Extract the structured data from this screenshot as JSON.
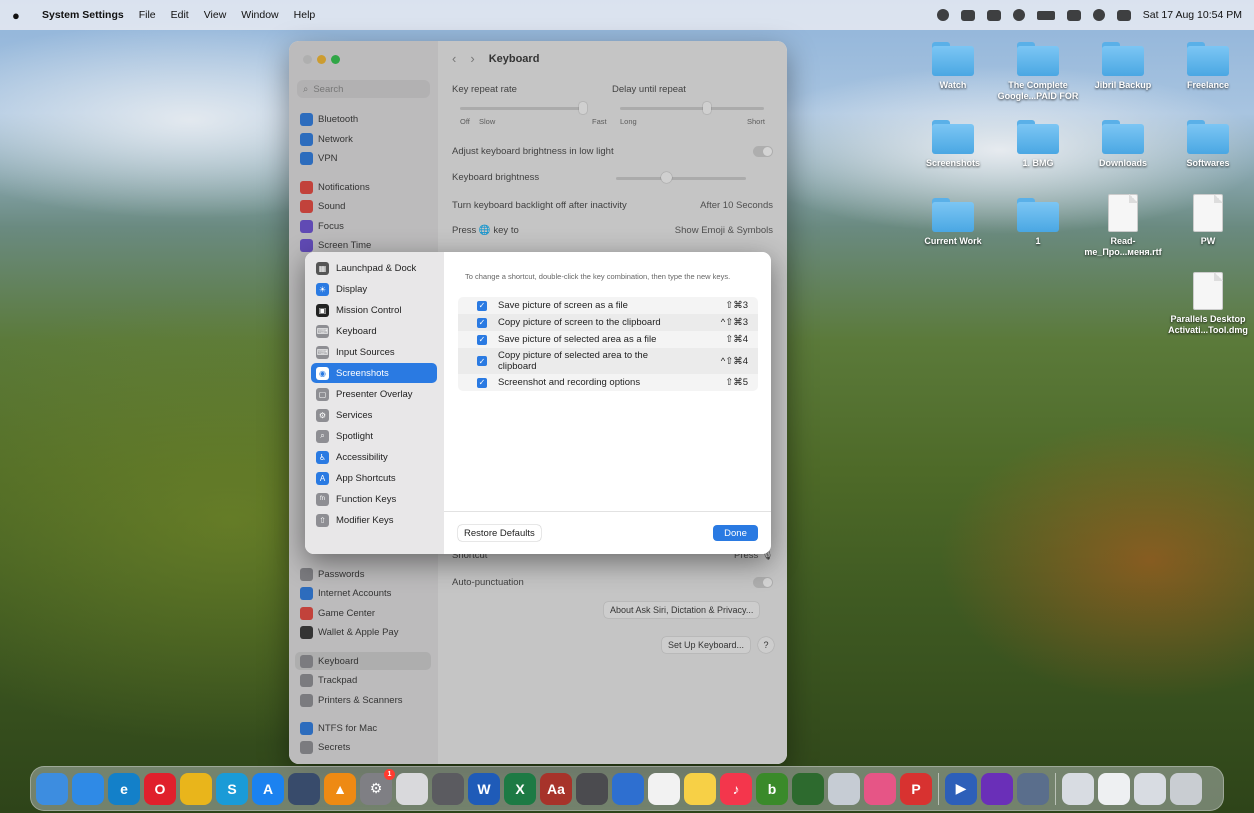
{
  "menubar": {
    "app_name": "System Settings",
    "menus": [
      "File",
      "Edit",
      "View",
      "Window",
      "Help"
    ],
    "clock": "Sat 17 Aug  10:54 PM"
  },
  "desktop": {
    "items": [
      {
        "label": "Watch",
        "kind": "folder"
      },
      {
        "label": "The Complete Google...PAID FOR",
        "kind": "folder"
      },
      {
        "label": "Jibril Backup",
        "kind": "folder"
      },
      {
        "label": "Freelance",
        "kind": "folder"
      },
      {
        "label": "Screenshots",
        "kind": "folder"
      },
      {
        "label": "1. BMG",
        "kind": "folder"
      },
      {
        "label": "Downloads",
        "kind": "folder"
      },
      {
        "label": "Softwares",
        "kind": "folder"
      },
      {
        "label": "Current Work",
        "kind": "folder"
      },
      {
        "label": "1",
        "kind": "folder"
      },
      {
        "label": "Read-me_Про...меня.rtf",
        "kind": "file"
      },
      {
        "label": "PW",
        "kind": "file"
      },
      {
        "label": "Parallels Desktop Activati...Tool.dmg",
        "kind": "file"
      }
    ]
  },
  "settings": {
    "search_placeholder": "Search",
    "title": "Keyboard",
    "sidebar": [
      {
        "label": "Bluetooth",
        "color": "#2a7ae2"
      },
      {
        "label": "Network",
        "color": "#2a7ae2"
      },
      {
        "label": "VPN",
        "color": "#2a7ae2"
      },
      {
        "label": "Notifications",
        "color": "#e8453c"
      },
      {
        "label": "Sound",
        "color": "#e8453c"
      },
      {
        "label": "Focus",
        "color": "#6b4fd6"
      },
      {
        "label": "Screen Time",
        "color": "#6b4fd6"
      },
      {
        "label": "Passwords",
        "color": "#8e8e93"
      },
      {
        "label": "Internet Accounts",
        "color": "#2a7ae2"
      },
      {
        "label": "Game Center",
        "color": "#e8453c"
      },
      {
        "label": "Wallet & Apple Pay",
        "color": "#333333"
      },
      {
        "label": "Keyboard",
        "color": "#8e8e93"
      },
      {
        "label": "Trackpad",
        "color": "#8e8e93"
      },
      {
        "label": "Printers & Scanners",
        "color": "#8e8e93"
      },
      {
        "label": "NTFS for Mac",
        "color": "#2a7ae2"
      },
      {
        "label": "Secrets",
        "color": "#8e8e93"
      }
    ],
    "main": {
      "key_repeat_rate": "Key repeat rate",
      "delay_until_repeat": "Delay until repeat",
      "repeat_scale": [
        "Off",
        "Slow",
        "Fast"
      ],
      "delay_scale": [
        "Long",
        "Short"
      ],
      "adjust_brightness": "Adjust keyboard brightness in low light",
      "keyboard_brightness": "Keyboard brightness",
      "backlight_off": "Turn keyboard backlight off after inactivity",
      "backlight_value": "After 10 Seconds",
      "press_key": "Press 🌐 key to",
      "press_key_value": "Show Emoji & Symbols",
      "shortcut": "Shortcut",
      "shortcut_value": "Press 🎙",
      "auto_punctuation": "Auto-punctuation",
      "about_siri": "About Ask Siri, Dictation & Privacy...",
      "setup_keyboard": "Set Up Keyboard...",
      "help": "?"
    }
  },
  "sheet": {
    "categories": [
      {
        "label": "Launchpad & Dock",
        "icon": "▦",
        "color": "#555555"
      },
      {
        "label": "Display",
        "icon": "☀",
        "color": "#2a7ae2"
      },
      {
        "label": "Mission Control",
        "icon": "▣",
        "color": "#222222"
      },
      {
        "label": "Keyboard",
        "icon": "⌨",
        "color": "#8e8e93"
      },
      {
        "label": "Input Sources",
        "icon": "⌨",
        "color": "#8e8e93"
      },
      {
        "label": "Screenshots",
        "icon": "◉",
        "color": "#8e8e93",
        "selected": true
      },
      {
        "label": "Presenter Overlay",
        "icon": "▢",
        "color": "#8e8e93"
      },
      {
        "label": "Services",
        "icon": "⚙",
        "color": "#8e8e93"
      },
      {
        "label": "Spotlight",
        "icon": "⌕",
        "color": "#8e8e93"
      },
      {
        "label": "Accessibility",
        "icon": "♿",
        "color": "#2a7ae2"
      },
      {
        "label": "App Shortcuts",
        "icon": "A",
        "color": "#2a7ae2"
      },
      {
        "label": "Function Keys",
        "icon": "fn",
        "color": "#8e8e93"
      },
      {
        "label": "Modifier Keys",
        "icon": "⇧",
        "color": "#8e8e93"
      }
    ],
    "hint": "To change a shortcut, double-click the key combination, then type the new keys.",
    "shortcuts": [
      {
        "label": "Save picture of screen as a file",
        "keys": "⇧⌘3",
        "checked": true
      },
      {
        "label": "Copy picture of screen to the clipboard",
        "keys": "^⇧⌘3",
        "checked": true
      },
      {
        "label": "Save picture of selected area as a file",
        "keys": "⇧⌘4",
        "checked": true
      },
      {
        "label": "Copy picture of selected area to the clipboard",
        "keys": "^⇧⌘4",
        "checked": true
      },
      {
        "label": "Screenshot and recording options",
        "keys": "⇧⌘5",
        "checked": true
      }
    ],
    "restore_defaults": "Restore Defaults",
    "done": "Done"
  },
  "dock": {
    "apps": [
      {
        "name": "Finder",
        "color": "#3d8de0",
        "glyph": ""
      },
      {
        "name": "Safari",
        "color": "#2f8ae6",
        "glyph": ""
      },
      {
        "name": "Edge",
        "color": "#1380c9",
        "glyph": "e"
      },
      {
        "name": "Opera",
        "color": "#e0202c",
        "glyph": "O"
      },
      {
        "name": "Chrome",
        "color": "#e9b51b",
        "glyph": ""
      },
      {
        "name": "Skype",
        "color": "#1a9bd7",
        "glyph": "S"
      },
      {
        "name": "App Store",
        "color": "#1b82f0",
        "glyph": "A"
      },
      {
        "name": "QuickTime",
        "color": "#384b6b",
        "glyph": ""
      },
      {
        "name": "VLC",
        "color": "#ee8a13",
        "glyph": "▲"
      },
      {
        "name": "System Settings",
        "color": "#7f7f84",
        "glyph": "⚙",
        "badge": "1"
      },
      {
        "name": "Launchpad",
        "color": "#d9d9dc",
        "glyph": ""
      },
      {
        "name": "Screenshot",
        "color": "#5b5b60",
        "glyph": ""
      },
      {
        "name": "Word",
        "color": "#1f5bb8",
        "glyph": "W"
      },
      {
        "name": "Excel",
        "color": "#1d7a44",
        "glyph": "X"
      },
      {
        "name": "Dictionary",
        "color": "#a7332a",
        "glyph": "Aa"
      },
      {
        "name": "Calculator",
        "color": "#4b4b4f",
        "glyph": ""
      },
      {
        "name": "Notes Blue",
        "color": "#2e6fd0",
        "glyph": ""
      },
      {
        "name": "Reminders",
        "color": "#f2f2f2",
        "glyph": ""
      },
      {
        "name": "Notes",
        "color": "#f7d046",
        "glyph": ""
      },
      {
        "name": "Music",
        "color": "#f4364c",
        "glyph": "♪"
      },
      {
        "name": "Bitdefender",
        "color": "#3a8a2a",
        "glyph": "b"
      },
      {
        "name": "Globe",
        "color": "#2d6a2e",
        "glyph": ""
      },
      {
        "name": "Preview",
        "color": "#c6ccd4",
        "glyph": ""
      },
      {
        "name": "Photo Booth",
        "color": "#e65586",
        "glyph": ""
      },
      {
        "name": "Presentation",
        "color": "#d83230",
        "glyph": "P"
      },
      {
        "name": "Keynote",
        "color": "#2d5fb9",
        "glyph": "▶"
      },
      {
        "name": "Podcasts",
        "color": "#6a2fb8",
        "glyph": ""
      },
      {
        "name": "Screen Sharing",
        "color": "#5a6e8c",
        "glyph": ""
      },
      {
        "name": "Keyboard Viewer",
        "color": "#d8dce2",
        "glyph": ""
      },
      {
        "name": "Document",
        "color": "#eef0f2",
        "glyph": ""
      },
      {
        "name": "Keyboard Viewer 2",
        "color": "#d8dce2",
        "glyph": ""
      },
      {
        "name": "Trash",
        "color": "#c9cdd2",
        "glyph": ""
      }
    ]
  }
}
